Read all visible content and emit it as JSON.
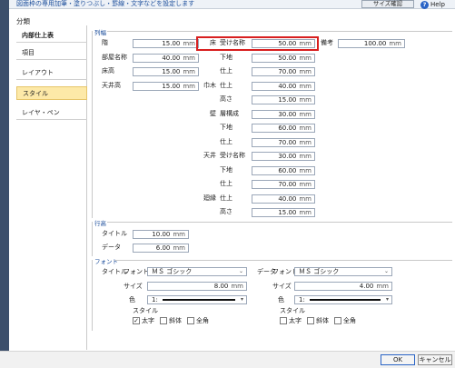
{
  "header": {
    "description": "図面枠の専用加筆・塗りつぶし・罫線・文字などを設定します",
    "size_check_label": "サイズ確認",
    "help_label": "Help"
  },
  "section_title": "分類",
  "nav": {
    "items": [
      {
        "label": "内部仕上表"
      },
      {
        "label": "項目"
      },
      {
        "label": "レイアウト"
      },
      {
        "label": "スタイル"
      },
      {
        "label": "レイヤ・ペン"
      }
    ]
  },
  "column_width": {
    "group_label": "列幅",
    "rows": [
      {
        "label": "階",
        "value": "15.00"
      },
      {
        "label": "部屋名称",
        "value": "40.00"
      },
      {
        "label": "床高",
        "value": "15.00"
      },
      {
        "label": "天井高",
        "value": "15.00"
      }
    ],
    "unit": "mm",
    "right_items": [
      {
        "cat": "床",
        "label": "受け名称",
        "value": "50.00"
      },
      {
        "cat": "",
        "label": "下地",
        "value": "50.00"
      },
      {
        "cat": "",
        "label": "仕上",
        "value": "70.00"
      },
      {
        "cat": "巾木",
        "label": "仕上",
        "value": "40.00"
      },
      {
        "cat": "",
        "label": "高さ",
        "value": "15.00"
      },
      {
        "cat": "壁",
        "label": "層構成",
        "value": "30.00"
      },
      {
        "cat": "",
        "label": "下地",
        "value": "60.00"
      },
      {
        "cat": "",
        "label": "仕上",
        "value": "70.00"
      },
      {
        "cat": "天井",
        "label": "受け名称",
        "value": "30.00"
      },
      {
        "cat": "",
        "label": "下地",
        "value": "60.00"
      },
      {
        "cat": "",
        "label": "仕上",
        "value": "70.00"
      },
      {
        "cat": "廻縁",
        "label": "仕上",
        "value": "40.00"
      },
      {
        "cat": "",
        "label": "高さ",
        "value": "15.00"
      }
    ],
    "remarks_label": "備考",
    "remarks_value": "100.00"
  },
  "row_height": {
    "group_label": "行高",
    "rows": [
      {
        "label": "タイトル",
        "value": "10.00"
      },
      {
        "label": "データ",
        "value": "6.00"
      }
    ],
    "unit": "mm"
  },
  "font": {
    "group_label": "フォント",
    "title": {
      "section_label": "タイトル",
      "font_label": "フォント",
      "font_value": "ＭＳ ゴシック",
      "size_label": "サイズ",
      "size_value": "8.00",
      "color_label": "色",
      "color_value": "1:",
      "style_label": "スタイル",
      "checks": [
        {
          "label": "太字",
          "checked": true
        },
        {
          "label": "斜体",
          "checked": false
        },
        {
          "label": "全角",
          "checked": false
        }
      ]
    },
    "data": {
      "section_label": "データ",
      "font_label": "フォント",
      "font_value": "ＭＳ ゴシック",
      "size_label": "サイズ",
      "size_value": "4.00",
      "color_label": "色",
      "color_value": "1:",
      "style_label": "スタイル",
      "checks": [
        {
          "label": "太字",
          "checked": false
        },
        {
          "label": "斜体",
          "checked": false
        },
        {
          "label": "全角",
          "checked": false
        }
      ]
    },
    "unit": "mm"
  },
  "footer": {
    "ok_label": "OK",
    "cancel_label": "キャンセル"
  },
  "colors": {
    "accent": "#2a64c6",
    "highlight": "#d81f1f",
    "selected_nav": "#fde9a8"
  }
}
